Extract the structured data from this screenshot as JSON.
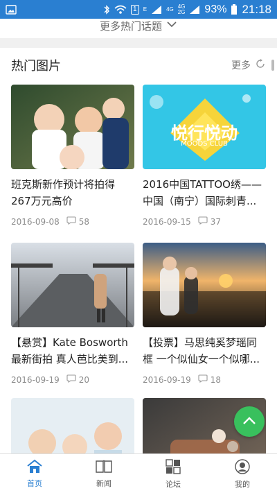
{
  "status_bar": {
    "battery_percent": "93%",
    "time": "21:18",
    "indicators": [
      "image-icon",
      "bluetooth-icon",
      "wifi-icon",
      "sim-icon",
      "signal-icon",
      "battery-icon"
    ],
    "sim_label": "1",
    "net_labels": [
      "E",
      "4G",
      "4G",
      "2G"
    ]
  },
  "top_strip": {
    "more_topics_label": "更多热门话题"
  },
  "section": {
    "title": "热门图片",
    "more_label": "更多"
  },
  "cards": [
    {
      "title": "班克斯新作预计将拍得267万元高价",
      "date": "2016-09-08",
      "comments": "58"
    },
    {
      "title": "2016中国TATTOO绣——中国（南宁）国际刺青...",
      "date": "2016-09-15",
      "comments": "37"
    },
    {
      "title": "【悬赏】Kate Bosworth 最新街拍 真人芭比美到...",
      "date": "2016-09-19",
      "comments": "20"
    },
    {
      "title": "【投票】马思纯奚梦瑶同框 一个似仙女一个似哪...",
      "date": "2016-09-19",
      "comments": "18"
    },
    {
      "title": "",
      "date": "",
      "comments": ""
    },
    {
      "title": "",
      "date": "",
      "comments": ""
    }
  ],
  "card2_overlay": {
    "main": "悦行悦动",
    "sub": "MOODS CLUB"
  },
  "bottom_nav": {
    "items": [
      "首页",
      "新闻",
      "论坛",
      "我的"
    ]
  },
  "colors": {
    "accent": "#2a7fd1",
    "fab": "#39c05d",
    "status_bar": "#2a7fd1"
  }
}
